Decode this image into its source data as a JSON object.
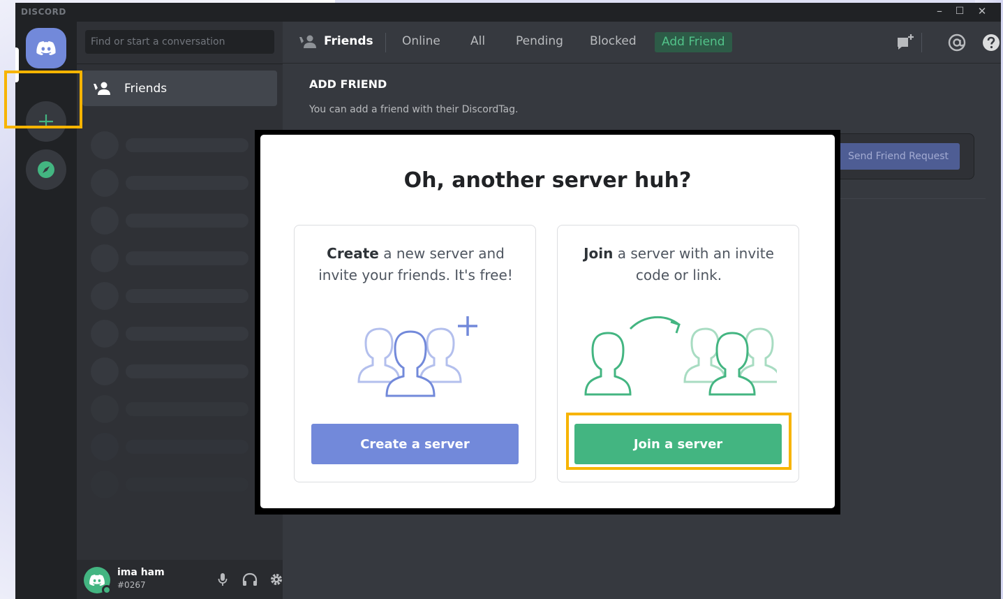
{
  "app": {
    "brand": "DISCORD",
    "window_controls": {
      "minimize": "–",
      "maximize": "☐",
      "close": "✕"
    }
  },
  "dm": {
    "search_placeholder": "Find or start a conversation",
    "friends_label": "Friends"
  },
  "user": {
    "name": "ima ham",
    "tag": "#0267"
  },
  "topnav": {
    "title": "Friends",
    "tabs": [
      "Online",
      "All",
      "Pending",
      "Blocked"
    ],
    "add_friend": "Add Friend"
  },
  "main": {
    "heading": "ADD FRIEND",
    "subtitle": "You can add a friend with their DiscordTag.",
    "send_button": "Send Friend Request"
  },
  "modal": {
    "title": "Oh, another server huh?",
    "create": {
      "bold": "Create",
      "text": " a new server and invite your friends. It's free!",
      "button": "Create a server"
    },
    "join": {
      "bold": "Join",
      "text": " a server with an invite code or link.",
      "button": "Join a server"
    }
  },
  "colors": {
    "blurple": "#7289da",
    "green": "#43b581",
    "highlight": "#f7b400"
  }
}
